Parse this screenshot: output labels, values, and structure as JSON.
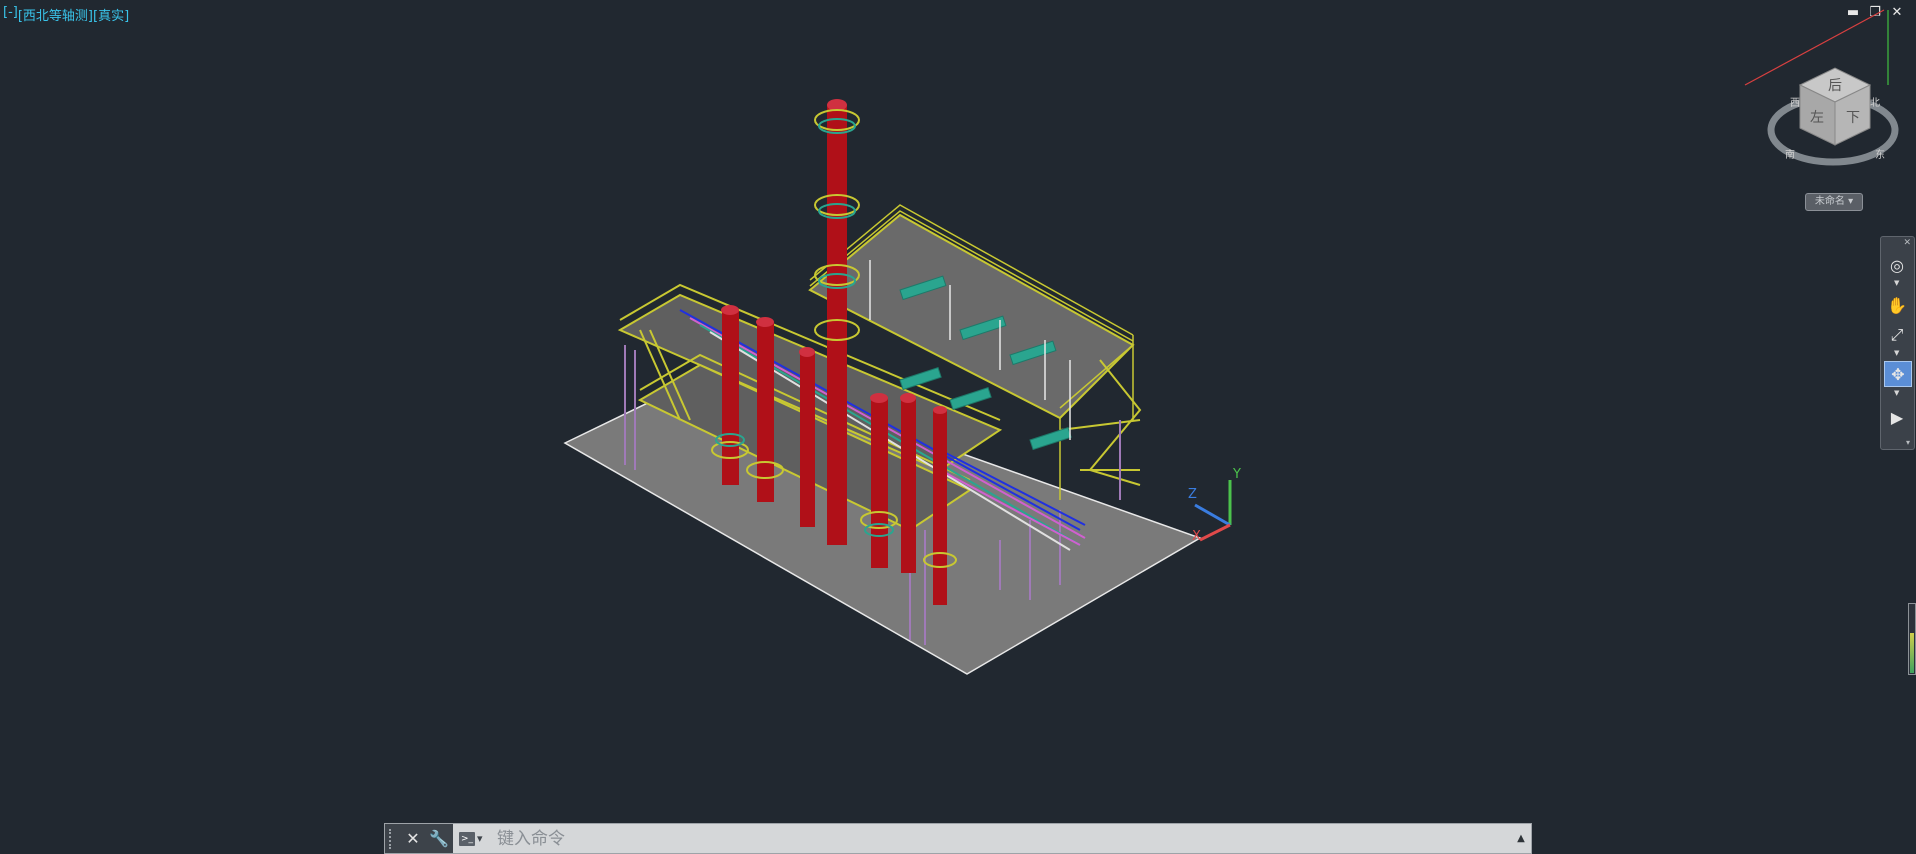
{
  "viewport": {
    "minus": "[-]",
    "view": "[西北等轴测]",
    "style": "[真实]"
  },
  "window_controls": {
    "minimize": "▬",
    "restore": "❐",
    "close": "✕"
  },
  "viewcube": {
    "top_face": "后",
    "front_face": "左",
    "right_face": "下",
    "compass_n": "北",
    "compass_s": "南",
    "compass_e": "东",
    "compass_w": "西",
    "ucs_menu": "未命名 ▾"
  },
  "ucs_axes": {
    "x": "X",
    "y": "Y",
    "z": "Z"
  },
  "command_line": {
    "placeholder": "键入命令",
    "close_icon": "close-icon",
    "customize_icon": "wrench-icon"
  },
  "colors": {
    "background": "#212830",
    "column_red": "#b01018",
    "platform_yellow": "#c8c832",
    "pipe_teal": "#2aa58f",
    "pipe_blue": "#2030e0",
    "pipe_magenta": "#d060d0",
    "slab_gray": "#7d7d7d"
  }
}
